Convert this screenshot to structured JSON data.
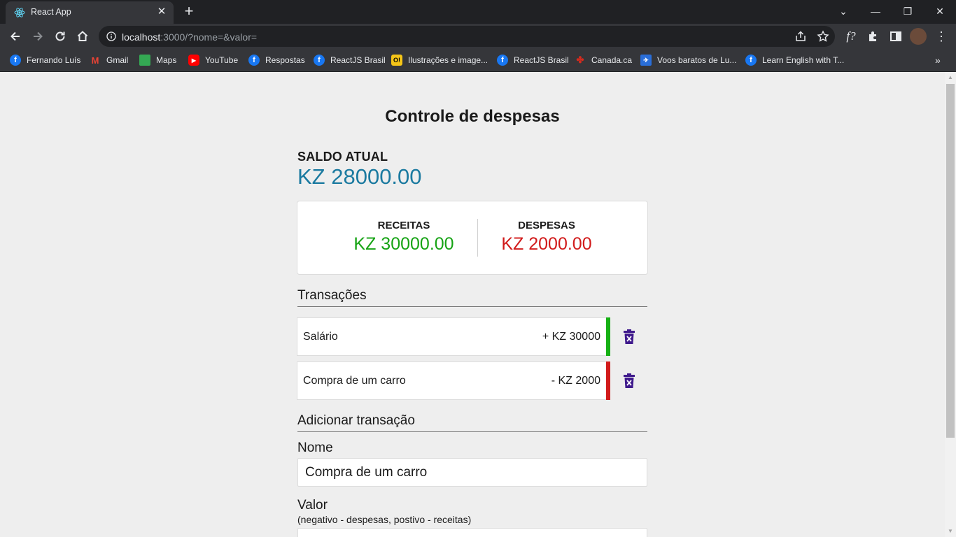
{
  "browser": {
    "tab_title": "React App",
    "url_host": "localhost",
    "url_rest": ":3000/?nome=&valor=",
    "bookmarks": [
      {
        "label": "Fernando Luís",
        "icon": "facebook-icon",
        "color": "#1877f2"
      },
      {
        "label": "Gmail",
        "icon": "gmail-icon",
        "color": "#ea4335"
      },
      {
        "label": "Maps",
        "icon": "maps-icon",
        "color": "#34a853"
      },
      {
        "label": "YouTube",
        "icon": "youtube-icon",
        "color": "#ff0000"
      },
      {
        "label": "Respostas",
        "icon": "facebook-icon",
        "color": "#1877f2"
      },
      {
        "label": "ReactJS Brasil",
        "icon": "facebook-icon",
        "color": "#1877f2"
      },
      {
        "label": "Ilustrações e image...",
        "icon": "oi-icon",
        "color": "#f5c518"
      },
      {
        "label": "ReactJS Brasil",
        "icon": "facebook-icon",
        "color": "#1877f2"
      },
      {
        "label": "Canada.ca",
        "icon": "maple-leaf-icon",
        "color": "#d52b1e"
      },
      {
        "label": "Voos baratos de Lu...",
        "icon": "flights-icon",
        "color": "#2a6ed8"
      },
      {
        "label": "Learn English with T...",
        "icon": "facebook-icon",
        "color": "#1877f2"
      }
    ]
  },
  "app": {
    "title": "Controle de despesas",
    "balance_label": "SALDO ATUAL",
    "balance_value": "KZ 28000.00",
    "income_label": "RECEITAS",
    "income_value": "KZ 30000.00",
    "expense_label": "DESPESAS",
    "expense_value": "KZ 2000.00",
    "transactions_heading": "Transações",
    "transactions": [
      {
        "name": "Salário",
        "amount": "+ KZ 30000",
        "type": "income"
      },
      {
        "name": "Compra de um carro",
        "amount": "- KZ 2000",
        "type": "expense"
      }
    ],
    "add_heading": "Adicionar transação",
    "name_label": "Nome",
    "name_value": "Compra de um carro",
    "value_label": "Valor",
    "value_hint": "(negativo - despesas, postivo - receitas)"
  },
  "colors": {
    "balance": "#1b7aa0",
    "income": "#16a314",
    "expense": "#d11a1a",
    "delete_icon": "#3f1a8c"
  }
}
